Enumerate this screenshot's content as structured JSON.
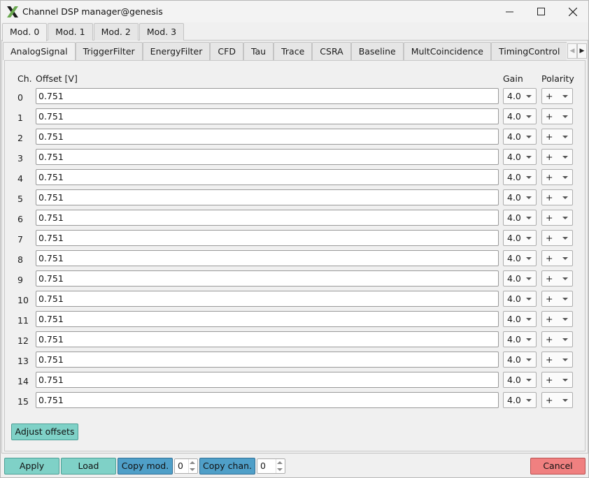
{
  "window": {
    "title": "Channel DSP manager@genesis"
  },
  "module_tabs": [
    "Mod. 0",
    "Mod. 1",
    "Mod. 2",
    "Mod. 3"
  ],
  "function_tabs": [
    "AnalogSignal",
    "TriggerFilter",
    "EnergyFilter",
    "CFD",
    "Tau",
    "Trace",
    "CSRA",
    "Baseline",
    "MultCoincidence",
    "TimingControl"
  ],
  "headers": {
    "ch": "Ch.",
    "offset": "Offset [V]",
    "gain": "Gain",
    "polarity": "Polarity"
  },
  "channels": [
    {
      "ch": "0",
      "offset": "0.751",
      "gain": "4.0",
      "polarity": "+"
    },
    {
      "ch": "1",
      "offset": "0.751",
      "gain": "4.0",
      "polarity": "+"
    },
    {
      "ch": "2",
      "offset": "0.751",
      "gain": "4.0",
      "polarity": "+"
    },
    {
      "ch": "3",
      "offset": "0.751",
      "gain": "4.0",
      "polarity": "+"
    },
    {
      "ch": "4",
      "offset": "0.751",
      "gain": "4.0",
      "polarity": "+"
    },
    {
      "ch": "5",
      "offset": "0.751",
      "gain": "4.0",
      "polarity": "+"
    },
    {
      "ch": "6",
      "offset": "0.751",
      "gain": "4.0",
      "polarity": "+"
    },
    {
      "ch": "7",
      "offset": "0.751",
      "gain": "4.0",
      "polarity": "+"
    },
    {
      "ch": "8",
      "offset": "0.751",
      "gain": "4.0",
      "polarity": "+"
    },
    {
      "ch": "9",
      "offset": "0.751",
      "gain": "4.0",
      "polarity": "+"
    },
    {
      "ch": "10",
      "offset": "0.751",
      "gain": "4.0",
      "polarity": "+"
    },
    {
      "ch": "11",
      "offset": "0.751",
      "gain": "4.0",
      "polarity": "+"
    },
    {
      "ch": "12",
      "offset": "0.751",
      "gain": "4.0",
      "polarity": "+"
    },
    {
      "ch": "13",
      "offset": "0.751",
      "gain": "4.0",
      "polarity": "+"
    },
    {
      "ch": "14",
      "offset": "0.751",
      "gain": "4.0",
      "polarity": "+"
    },
    {
      "ch": "15",
      "offset": "0.751",
      "gain": "4.0",
      "polarity": "+"
    }
  ],
  "adjust_offsets_label": "Adjust offsets",
  "footer": {
    "apply": "Apply",
    "load": "Load",
    "copy_mod": "Copy mod.",
    "copy_mod_value": "0",
    "copy_chan": "Copy chan.",
    "copy_chan_value": "0",
    "cancel": "Cancel"
  },
  "colors": {
    "teal_button": "#7fd1c7",
    "blue_button": "#4f9fc8",
    "red_button": "#f08080"
  }
}
